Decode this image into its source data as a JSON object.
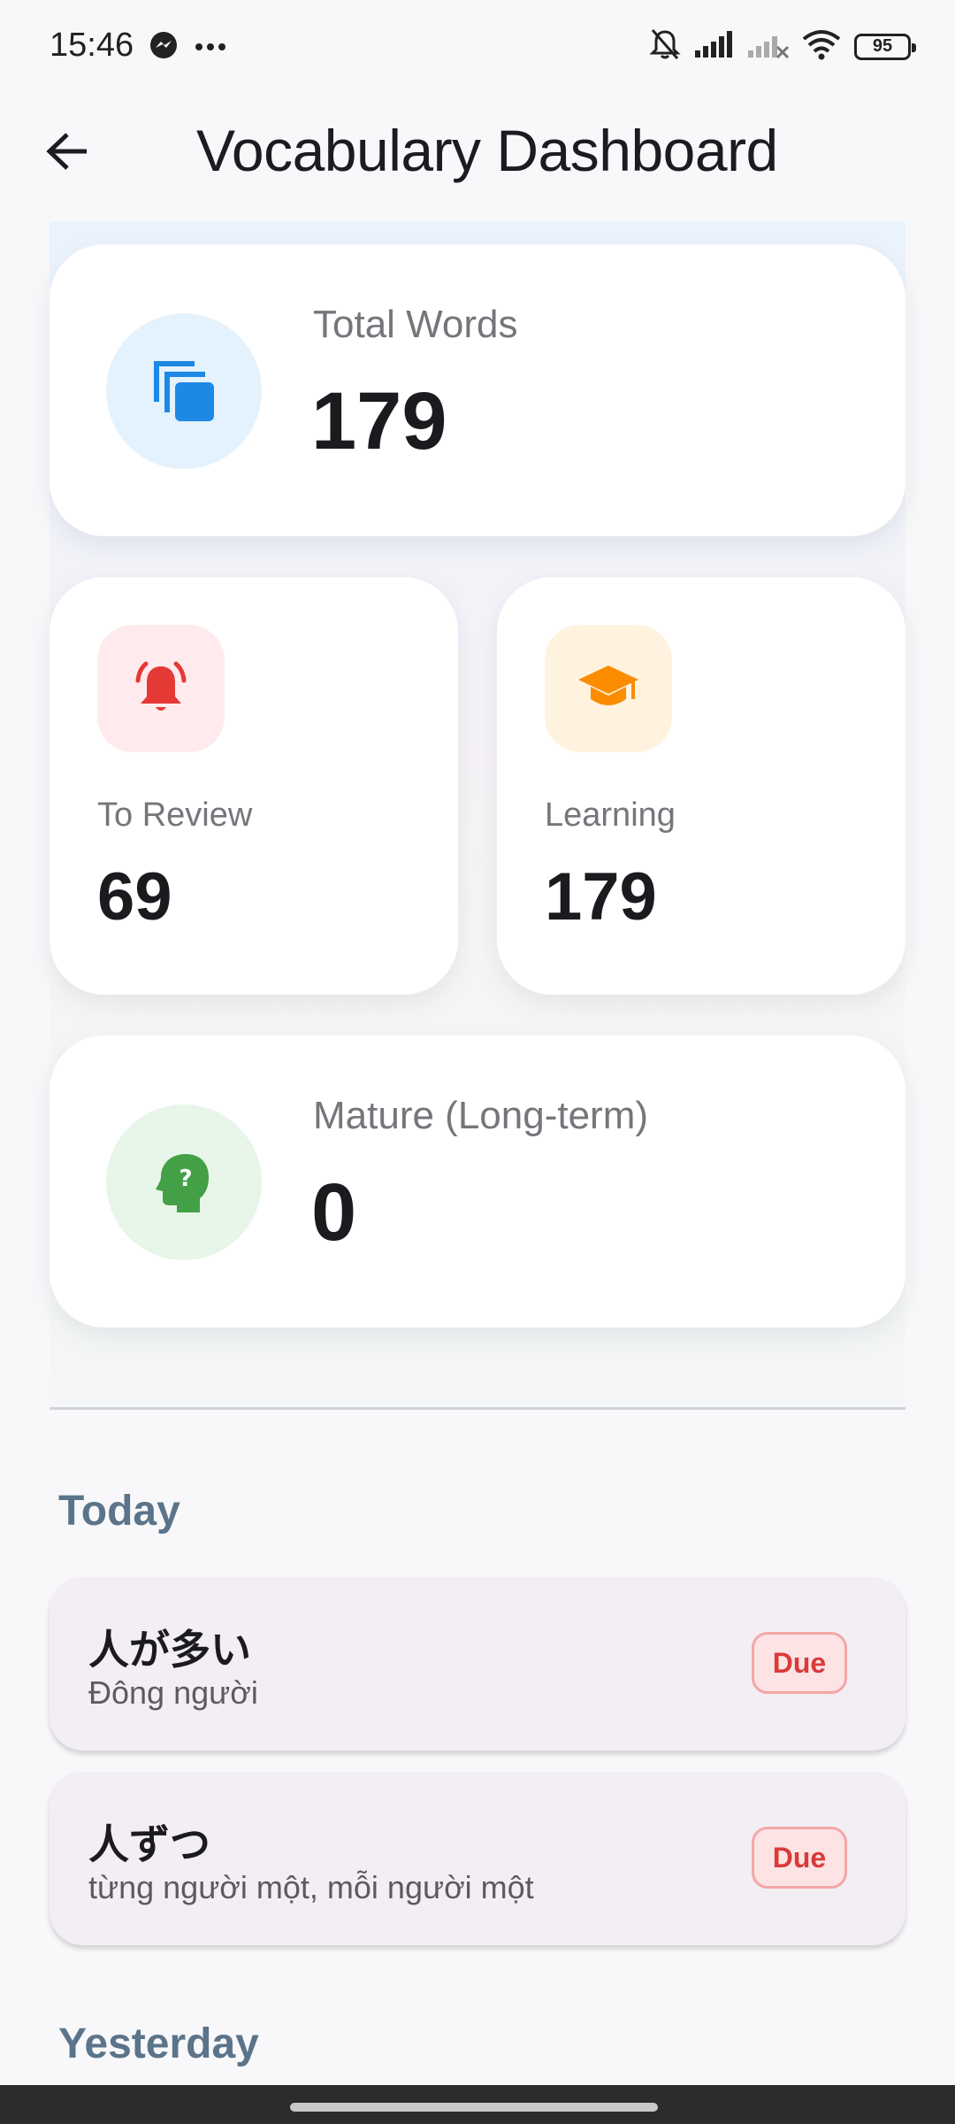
{
  "status_bar": {
    "time": "15:46",
    "battery": "95",
    "icons": [
      "messenger-icon",
      "more-icon",
      "bell-off-icon",
      "signal-icon",
      "signal-no-service-icon",
      "wifi-icon",
      "battery-icon"
    ]
  },
  "app_bar": {
    "title": "Vocabulary Dashboard",
    "back_icon": "arrow-left-icon"
  },
  "stats": {
    "total": {
      "label": "Total Words",
      "value": "179",
      "icon": "cards-icon",
      "color": "#1e88e5",
      "bg": "#e3f2fd"
    },
    "review": {
      "label": "To Review",
      "value": "69",
      "icon": "alarm-bell-icon",
      "color": "#e53935",
      "bg": "#ffebee"
    },
    "learning": {
      "label": "Learning",
      "value": "179",
      "icon": "graduation-cap-icon",
      "color": "#fb8c00",
      "bg": "#fff3e0"
    },
    "mature": {
      "label": "Mature (Long-term)",
      "value": "0",
      "icon": "head-question-icon",
      "color": "#43a047",
      "bg": "#e8f5e9"
    }
  },
  "sections": {
    "today": "Today",
    "yesterday": "Yesterday"
  },
  "today_items": [
    {
      "term": "人が多い",
      "meaning": "Đông người",
      "status": "Due"
    },
    {
      "term": "人ずつ",
      "meaning": "từng người một, mỗi người một",
      "status": "Due"
    }
  ],
  "colors": {
    "section_header": "#5b7489",
    "due_text": "#d93a3a",
    "card_bg": "#ffffff",
    "item_bg": "#f3eef4"
  }
}
